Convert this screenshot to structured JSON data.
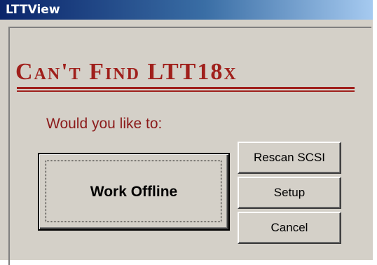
{
  "window": {
    "title": "LTTView"
  },
  "dialog": {
    "heading": "Can't Find LTT18x",
    "prompt": "Would you like to:"
  },
  "buttons": {
    "work_offline": "Work Offline",
    "rescan_scsi": "Rescan SCSI",
    "setup": "Setup",
    "cancel": "Cancel"
  },
  "colors": {
    "title_bar_start": "#0a246a",
    "title_bar_end": "#a6caf0",
    "heading": "#a0201c",
    "prompt": "#8b1a1a",
    "face": "#d4d0c8"
  }
}
